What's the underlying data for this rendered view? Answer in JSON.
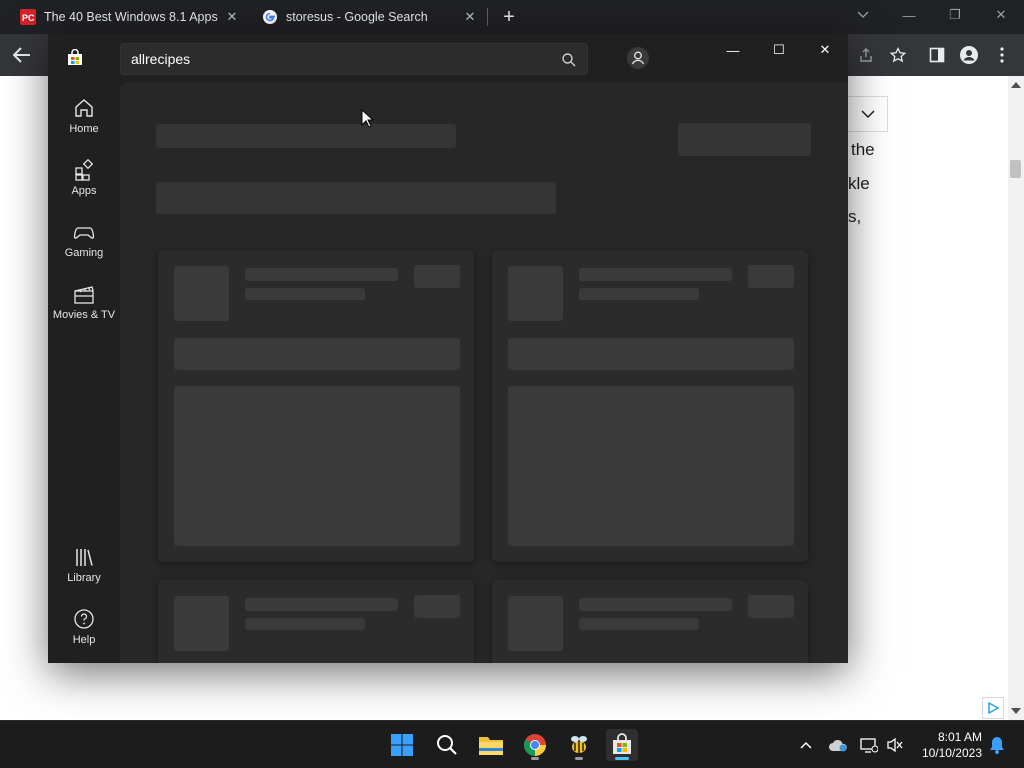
{
  "browser": {
    "tabs": [
      {
        "title": "The 40 Best Windows 8.1 Apps |",
        "favicon": "pcmag-icon"
      },
      {
        "title": "storesus - Google Search",
        "favicon": "google-icon"
      }
    ],
    "page_fragments": [
      "the",
      "kle",
      "s,"
    ]
  },
  "store": {
    "search_value": "allrecipes",
    "nav": {
      "home": "Home",
      "apps": "Apps",
      "gaming": "Gaming",
      "movies": "Movies & TV",
      "library": "Library",
      "help": "Help"
    }
  },
  "taskbar": {
    "time": "8:01 AM",
    "date": "10/10/2023",
    "apps": [
      "start-icon",
      "search-icon",
      "file-explorer-icon",
      "chrome-icon",
      "bee-app-icon",
      "microsoft-store-icon"
    ]
  },
  "colors": {
    "store_bg": "#202020",
    "store_content": "#272727",
    "placeholder": "#353535",
    "chrome_dark": "#202124",
    "accent": "#4cc2ff"
  }
}
